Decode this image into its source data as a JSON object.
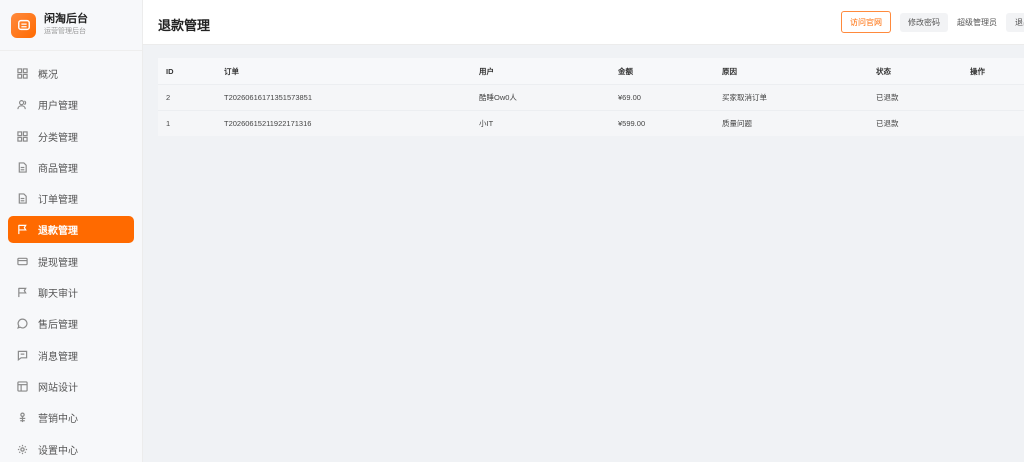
{
  "brand": {
    "title": "闲淘后台",
    "subtitle": "运营管理后台"
  },
  "sidebar": {
    "items": [
      {
        "label": "概况",
        "icon": "dashboard-icon"
      },
      {
        "label": "用户管理",
        "icon": "users-icon"
      },
      {
        "label": "分类管理",
        "icon": "grid-icon"
      },
      {
        "label": "商品管理",
        "icon": "document-icon"
      },
      {
        "label": "订单管理",
        "icon": "document-icon"
      },
      {
        "label": "退款管理",
        "icon": "flag-icon",
        "active": true
      },
      {
        "label": "提现管理",
        "icon": "card-icon"
      },
      {
        "label": "聊天审计",
        "icon": "flag-icon"
      },
      {
        "label": "售后管理",
        "icon": "chat-icon"
      },
      {
        "label": "消息管理",
        "icon": "message-icon"
      },
      {
        "label": "网站设计",
        "icon": "layout-icon"
      },
      {
        "label": "营销中心",
        "icon": "marketing-icon"
      },
      {
        "label": "设置中心",
        "icon": "gear-icon"
      }
    ]
  },
  "header": {
    "title": "退款管理",
    "visit_label": "访问官网",
    "change_pwd_label": "修改密码",
    "admin_label": "超级管理员",
    "logout_label": "退出"
  },
  "table": {
    "columns": [
      "ID",
      "订单",
      "用户",
      "金额",
      "原因",
      "状态",
      "操作"
    ],
    "rows": [
      {
        "id": "2",
        "order": "T20260616171351573851",
        "user": "酷睡Ow0人",
        "amount": "¥69.00",
        "reason": "买家取消订单",
        "status": "已退款"
      },
      {
        "id": "1",
        "order": "T20260615211922171316",
        "user": "小IT",
        "amount": "¥599.00",
        "reason": "质量问题",
        "status": "已退款"
      }
    ]
  },
  "colors": {
    "accent": "#ff6a00"
  }
}
